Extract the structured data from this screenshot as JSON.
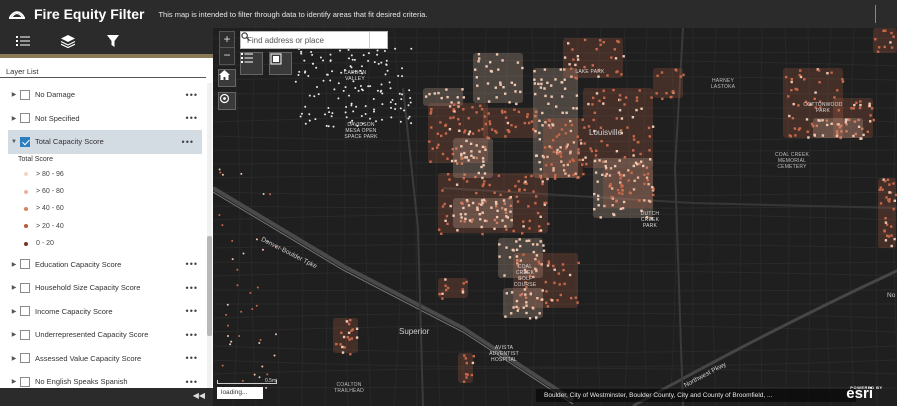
{
  "header": {
    "title": "Fire Equity Filter",
    "subtitle": "This map is intended to filter through data to identify areas that fit desired criteria."
  },
  "toolbar": {
    "icons": [
      "list-icon",
      "layers-icon",
      "filter-icon"
    ]
  },
  "panel": {
    "tab_label": "Layer List"
  },
  "layers": [
    {
      "label": "No Damage",
      "checked": false,
      "expanded": false
    },
    {
      "label": "Not Specified",
      "checked": false,
      "expanded": false
    },
    {
      "label": "Total Capacity Score",
      "checked": true,
      "expanded": true
    },
    {
      "label": "Education Capacity Score",
      "checked": false,
      "expanded": false
    },
    {
      "label": "Household Size Capacity Score",
      "checked": false,
      "expanded": false
    },
    {
      "label": "Income Capacity Score",
      "checked": false,
      "expanded": false
    },
    {
      "label": "Underrepresented Capacity Score",
      "checked": false,
      "expanded": false
    },
    {
      "label": "Assessed Value Capacity Score",
      "checked": false,
      "expanded": false
    },
    {
      "label": "No English Speaks Spanish",
      "checked": false,
      "expanded": false
    }
  ],
  "legend": {
    "title": "Total Score",
    "items": [
      {
        "label": "> 80 - 96",
        "color": "#f3d5c4"
      },
      {
        "label": "> 60 - 80",
        "color": "#ebb59a"
      },
      {
        "label": "> 40 - 60",
        "color": "#d9825f"
      },
      {
        "label": "> 20 - 40",
        "color": "#b65b3c"
      },
      {
        "label": "0 - 20",
        "color": "#7a3520"
      }
    ]
  },
  "map": {
    "search_placeholder": "Find address or place",
    "zoom_in": "+",
    "zoom_out": "−",
    "labels": {
      "carbon_valley": "CARBON VALLEY",
      "lake_park": "LAKE PARK",
      "harney_lastoka": "HARNEY LASTOKA",
      "cottonwood_park": "COTTONWOOD PARK",
      "davidson_mesa": "DAVIDSON MESA OPEN SPACE PARK",
      "louisville": "Louisville",
      "coal_creek_cemetery": "COAL CREEK MEMORIAL CEMETERY",
      "dutch_creek_park": "DUTCH CREEK PARK",
      "coal_creek_golf": "COAL CREEK GOLF COURSE",
      "superior": "Superior",
      "avista_hospital": "AVISTA ADVENTIST HOSPITAL",
      "coalton_trailhead": "COALTON TRAILHEAD"
    },
    "road_labels": {
      "denver_boulder_tpke": "Denver-Boulder Tpke",
      "northwest_pkwy": "Northwest Pkwy",
      "edge_label": "No"
    },
    "attribution": "Boulder, City of Westminster, Boulder County, City and County of Broomfield, ...",
    "loading_text": "loading...",
    "scale_text": "0.5mi",
    "powered_by": "POWERED BY",
    "esri_logo": "esri"
  },
  "colors": {
    "header_bg": "#2b2b2b",
    "accent": "#8a7a56",
    "selected_row": "#d3dbe3",
    "checkbox_checked": "#2a7fbf",
    "map_bg": "#1f1f1f",
    "parcel_orange": "#c7684a",
    "parcel_light": "#efc7b0"
  }
}
